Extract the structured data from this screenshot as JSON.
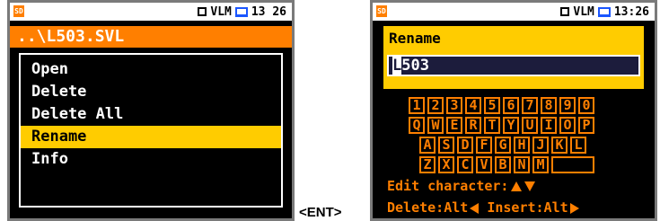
{
  "status": {
    "sd_label": "SD",
    "mode": "VLM",
    "time_left": "13 26",
    "time_right": "13:26"
  },
  "left": {
    "path": "..\\L503.SVL",
    "menu": [
      {
        "label": "Open"
      },
      {
        "label": "Delete"
      },
      {
        "label": "Delete All"
      },
      {
        "label": "Rename",
        "selected": true
      },
      {
        "label": "Info"
      }
    ]
  },
  "right": {
    "title": "Rename",
    "value_cursor": "L",
    "value_rest": "503",
    "keyboard": {
      "row1": [
        "1",
        "2",
        "3",
        "4",
        "5",
        "6",
        "7",
        "8",
        "9",
        "0"
      ],
      "row2": [
        "Q",
        "W",
        "E",
        "R",
        "T",
        "Y",
        "U",
        "I",
        "O",
        "P"
      ],
      "row3": [
        "A",
        "S",
        "D",
        "F",
        "G",
        "H",
        "J",
        "K",
        "L"
      ],
      "row4": [
        "Z",
        "X",
        "C",
        "V",
        "B",
        "N",
        "M"
      ]
    },
    "hint_edit": "Edit character:",
    "hint_delete": "Delete:Alt",
    "hint_insert": " Insert:Alt"
  },
  "ent_label": "<ENT>",
  "colors": {
    "orange": "#ff7f00",
    "yellow": "#ffcc00",
    "pc_blue": "#1a56ff"
  }
}
